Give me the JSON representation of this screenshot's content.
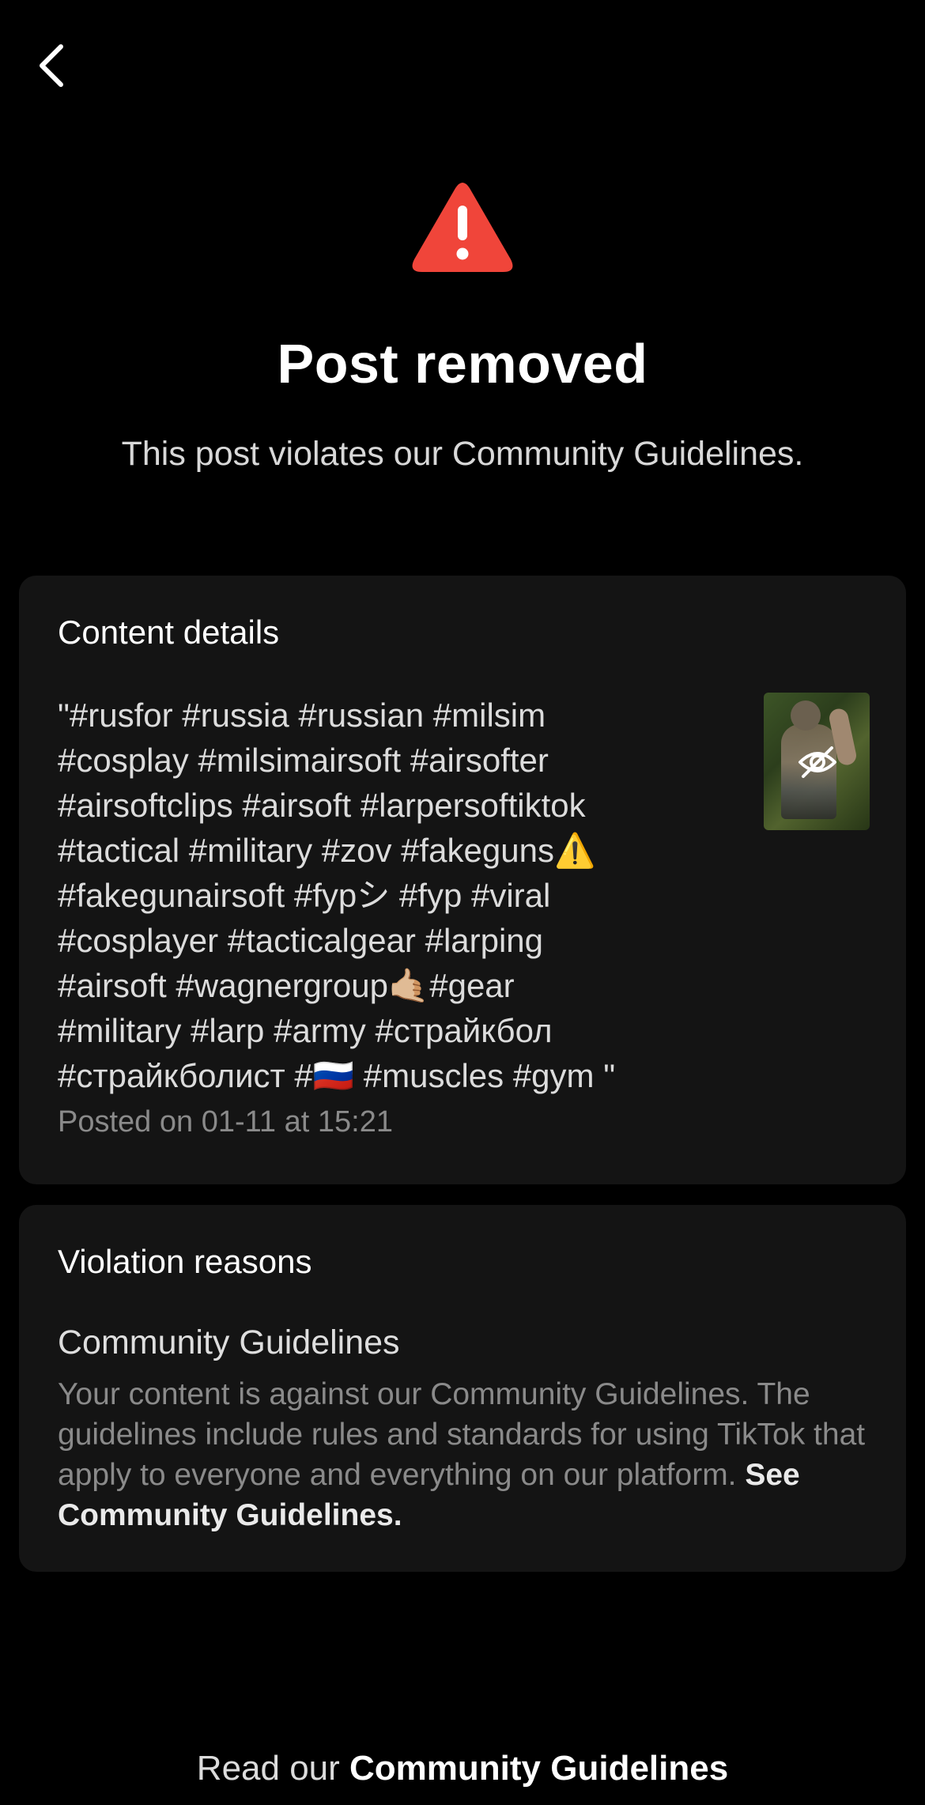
{
  "nav": {
    "back_icon": "chevron-left-icon"
  },
  "header": {
    "icon": "warning-triangle-icon",
    "icon_color": "#F0453A",
    "title": "Post removed",
    "subtitle": "This post violates our Community Guidelines."
  },
  "content_details": {
    "heading": "Content details",
    "caption": "\"#rusfor #russia #russian #milsim\n#cosplay #milsimairsoft #airsofter\n#airsoftclips #airsoft #larpersoftiktok\n#tactical #military #zov #fakeguns⚠️\n#fakegunairsoft #fypシ #fyp #viral\n#cosplayer #tacticalgear #larping\n#airsoft #wagnergroup🤙🏼#gear\n#military #larp #army #страйкбол\n#страйкболист #🇷🇺 #muscles #gym \"",
    "posted": "Posted on 01-11 at 15:21",
    "thumbnail_icon": "eye-off-icon"
  },
  "violation": {
    "heading": "Violation reasons",
    "reason_title": "Community Guidelines",
    "reason_text": "Your content is against our Community Guidelines. The guidelines include rules and standards for using TikTok that apply to everyone and everything on our platform. ",
    "reason_link": "See Community Guidelines."
  },
  "footer": {
    "prefix": "Read our ",
    "link": "Community Guidelines"
  },
  "colors": {
    "background": "#000000",
    "card": "#141414",
    "muted_text": "#8A8A8A"
  }
}
